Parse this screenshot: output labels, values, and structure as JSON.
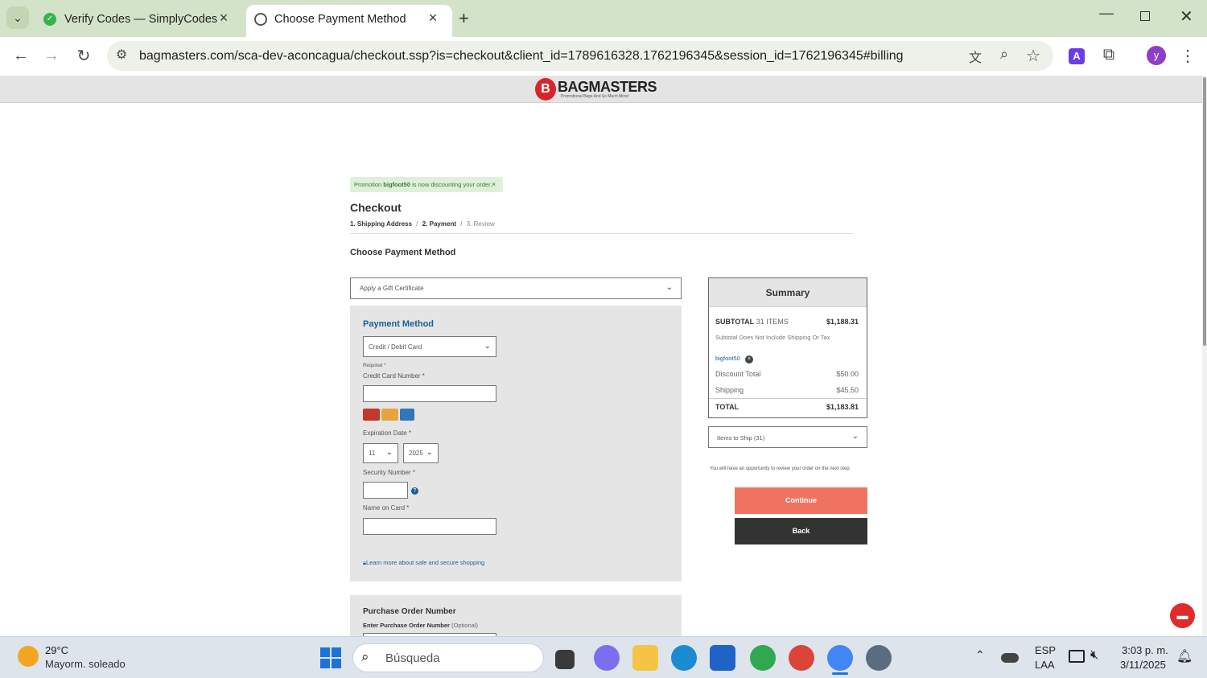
{
  "browser": {
    "tabs": [
      {
        "title": "Verify Codes — SimplyCodes",
        "active": false
      },
      {
        "title": "Choose Payment Method",
        "active": true
      }
    ],
    "url": "bagmasters.com/sca-dev-aconcagua/checkout.ssp?is=checkout&client_id=1789616328.1762196345&session_id=1762196345#billing",
    "profile_initial": "y",
    "extension_initial": "A"
  },
  "site": {
    "logo_text": "BAGMASTERS",
    "logo_tagline": "Promotional Bags And So Much More!"
  },
  "promo": {
    "prefix": "Promotion ",
    "code": "bigfoot50",
    "suffix": " is now discounting your order.",
    "close": "×"
  },
  "checkout": {
    "title": "Checkout",
    "steps": [
      "1. Shipping Address",
      "2. Payment",
      "3. Review"
    ],
    "separator": "/",
    "section_title": "Choose Payment Method",
    "gift_certificate": "Apply a Gift Certificate"
  },
  "payment": {
    "title": "Payment Method",
    "method_selected": "Credit / Debit Card",
    "required_note": "Required *",
    "card_number_label": "Credit Card Number *",
    "expiration_label": "Expiration Date *",
    "exp_month": "11",
    "exp_year": "2025",
    "security_label": "Security Number *",
    "name_label": "Name on Card *",
    "secure_link": "Learn more about safe and secure shopping",
    "card_brands": [
      "mastercard",
      "visa",
      "amex"
    ]
  },
  "purchase_order": {
    "title": "Purchase Order Number",
    "label": "Enter Purchase Order Number",
    "optional": "(Optional)"
  },
  "summary": {
    "title": "Summary",
    "subtotal_label": "SUBTOTAL",
    "items_count": "31 ITEMS",
    "subtotal_value": "$1,188.31",
    "subtotal_note": "Subtotal Does Not Include Shipping Or Tax",
    "promo_code": "bigfoot50",
    "discount_label": "Discount Total",
    "discount_value": "$50.00",
    "shipping_label": "Shipping",
    "shipping_value": "$45.50",
    "total_label": "TOTAL",
    "total_value": "$1,183.81",
    "items_to_ship": "Items to Ship (31)",
    "review_note": "You will have an opportunity to review your order on the next step.",
    "continue_label": "Continue",
    "back_label": "Back"
  },
  "taskbar": {
    "temperature": "29°C",
    "weather": "Mayorm. soleado",
    "search_placeholder": "Búsqueda",
    "lang_top": "ESP",
    "lang_bottom": "LAA",
    "time": "3:03 p. m.",
    "date": "3/11/2025"
  },
  "colors": {
    "continue": "#ef7360",
    "back": "#333333",
    "payment_title": "#1a5e96",
    "promo_bg": "#dff0d8",
    "tabstrip": "#d3e3c9"
  }
}
